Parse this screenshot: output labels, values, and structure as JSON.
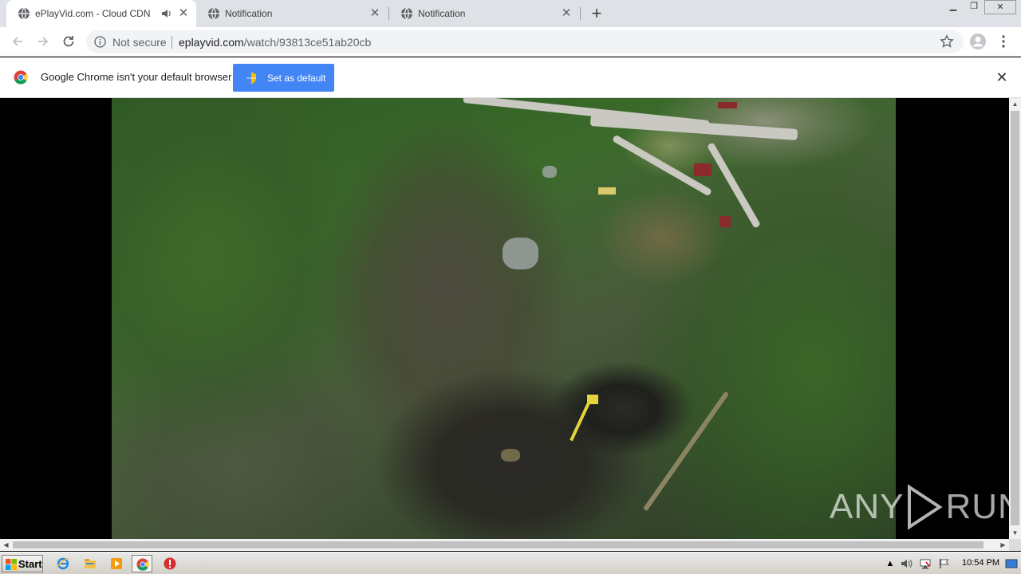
{
  "browser": {
    "tabs": [
      {
        "title": "ePlayVid.com - Cloud CDN",
        "active": true,
        "audio": true
      },
      {
        "title": "Notification",
        "active": false
      },
      {
        "title": "Notification",
        "active": false
      }
    ],
    "address": {
      "security_label": "Not secure",
      "host": "eplayvid.com",
      "path": "/watch/93813ce51ab20cb"
    }
  },
  "infobar": {
    "message": "Google Chrome isn't your default browser",
    "button_label": "Set as default"
  },
  "watermark": {
    "left_text": "ANY",
    "right_text": "RUN"
  },
  "taskbar": {
    "start_label": "Start",
    "clock": "10:54 PM",
    "pinned": [
      "internet-explorer-icon",
      "file-explorer-icon",
      "media-player-icon",
      "chrome-icon",
      "stop-icon"
    ]
  },
  "colors": {
    "button_blue": "#4285f4",
    "tabstrip": "#dee1e6"
  }
}
